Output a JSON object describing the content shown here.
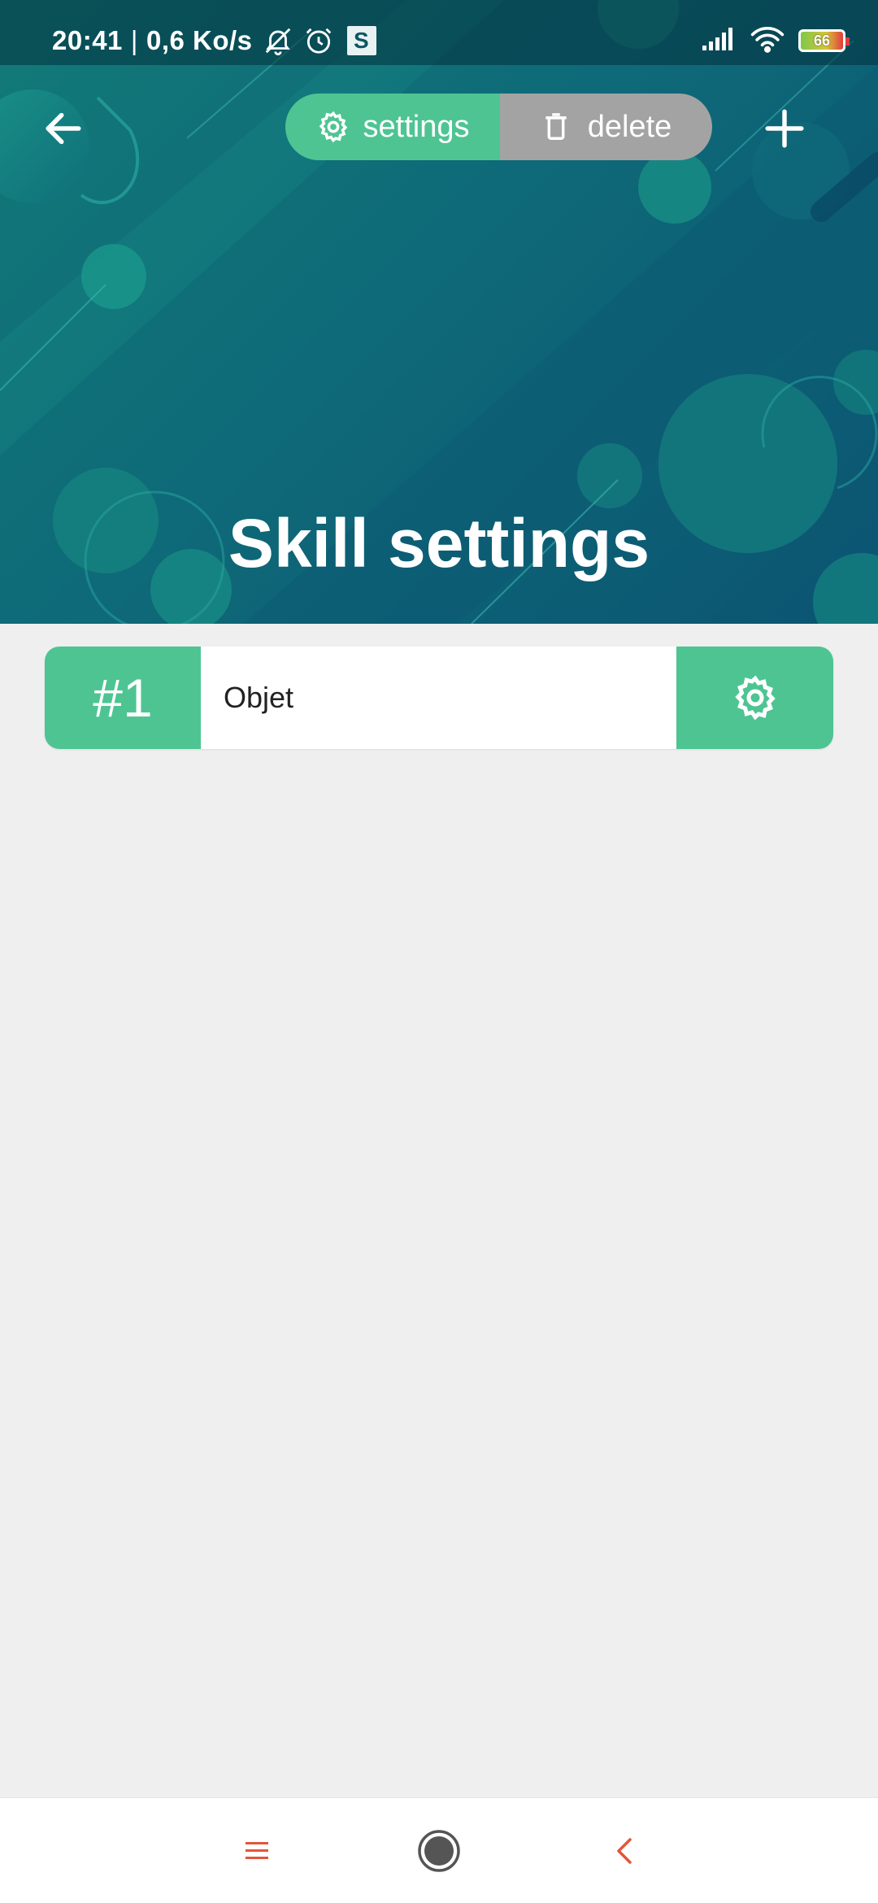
{
  "status_bar": {
    "time": "20:41",
    "separator": "|",
    "network_speed": "0,6 Ko/s",
    "app_badge": "S",
    "battery_level": "66",
    "icons": [
      "mute-bell-icon",
      "alarm-clock-icon",
      "signal-icon",
      "wifi-icon",
      "battery-icon"
    ]
  },
  "toolbar": {
    "settings_label": "settings",
    "delete_label": "delete",
    "icons": [
      "back-arrow-icon",
      "gear-icon",
      "trash-icon",
      "plus-icon"
    ]
  },
  "page": {
    "title": "Skill settings"
  },
  "skills": [
    {
      "number": "#1",
      "name": "Objet"
    }
  ],
  "navbar": {
    "icons": [
      "menu-icon",
      "home-icon",
      "back-chevron-icon"
    ]
  },
  "colors": {
    "accent_green": "#4ec493",
    "delete_gray": "#a3a3a3",
    "hero_teal": "#0e6a78",
    "background": "#efefef",
    "nav_accent": "#e2553a"
  }
}
